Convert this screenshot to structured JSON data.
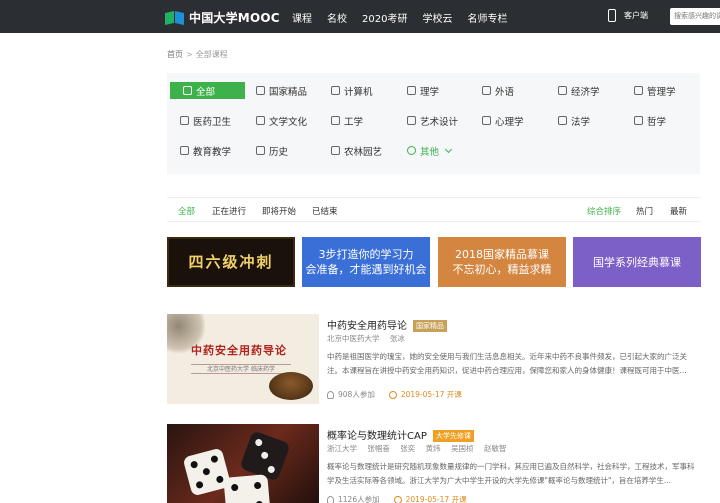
{
  "header": {
    "logo_text": "中国大学MOOC",
    "nav": [
      "课程",
      "名校",
      "2020考研",
      "学校云",
      "名师专栏"
    ],
    "mobile_label": "客户端",
    "search_placeholder": "搜索感兴趣的课程"
  },
  "breadcrumb": {
    "home": "首页",
    "separator": ">",
    "current": "全部课程"
  },
  "categories": [
    [
      "全部",
      "国家精品",
      "计算机",
      "理学",
      "外语",
      "经济学",
      "管理学"
    ],
    [
      "医药卫生",
      "文学文化",
      "工学",
      "艺术设计",
      "心理学",
      "法学",
      "哲学"
    ],
    [
      "教育教学",
      "历史",
      "农林园艺",
      "其他"
    ]
  ],
  "filters": {
    "status": [
      "全部",
      "正在进行",
      "即将开始",
      "已结束"
    ],
    "sort": [
      "综合排序",
      "热门",
      "最新"
    ]
  },
  "banners": [
    {
      "text": "四六级冲刺"
    },
    {
      "line1": "3步打造你的学习力",
      "line2": "会准备，才能遇到好机会"
    },
    {
      "line1": "2018国家精品慕课",
      "line2": "不忘初心，精益求精"
    },
    {
      "line1": "国学系列经典慕课",
      "line2": ""
    }
  ],
  "courses": [
    {
      "title": "中药安全用药导论",
      "tag": "国家精品",
      "school": "北京中医药大学",
      "teachers": [
        "张冰"
      ],
      "desc": "中药是祖国医学的瑰宝，她的安全使用与我们生活息息相关。近年来中药不良事件频发，已引起大家的广泛关注。本课程旨在讲授中药安全用药知识，促进中药合理应用，保障您和家人的身体健康！课程既可用于中医...",
      "enrolled": "908人参加",
      "start": "2019-05-17 开课",
      "thumb_title": "中药安全用药导论",
      "thumb_sub": "北京中医药大学 临床药学"
    },
    {
      "title": "概率论与数理统计CAP",
      "tag": "大学先修课",
      "school": "浙江大学",
      "teachers": [
        "张帼奋",
        "张奕",
        "黄炜",
        "吴国桢",
        "赵敏智"
      ],
      "desc": "概率论与数理统计是研究随机现象数量规律的一门学科，其应用已遍及自然科学，社会科学，工程技术，军事科学及生活实际等各领域。浙江大学为广大中学生开设的大学先修课\"概率论与数理统计\"，旨在培养学生...",
      "enrolled": "1126人参加",
      "start": "2019-05-17 开课"
    }
  ]
}
